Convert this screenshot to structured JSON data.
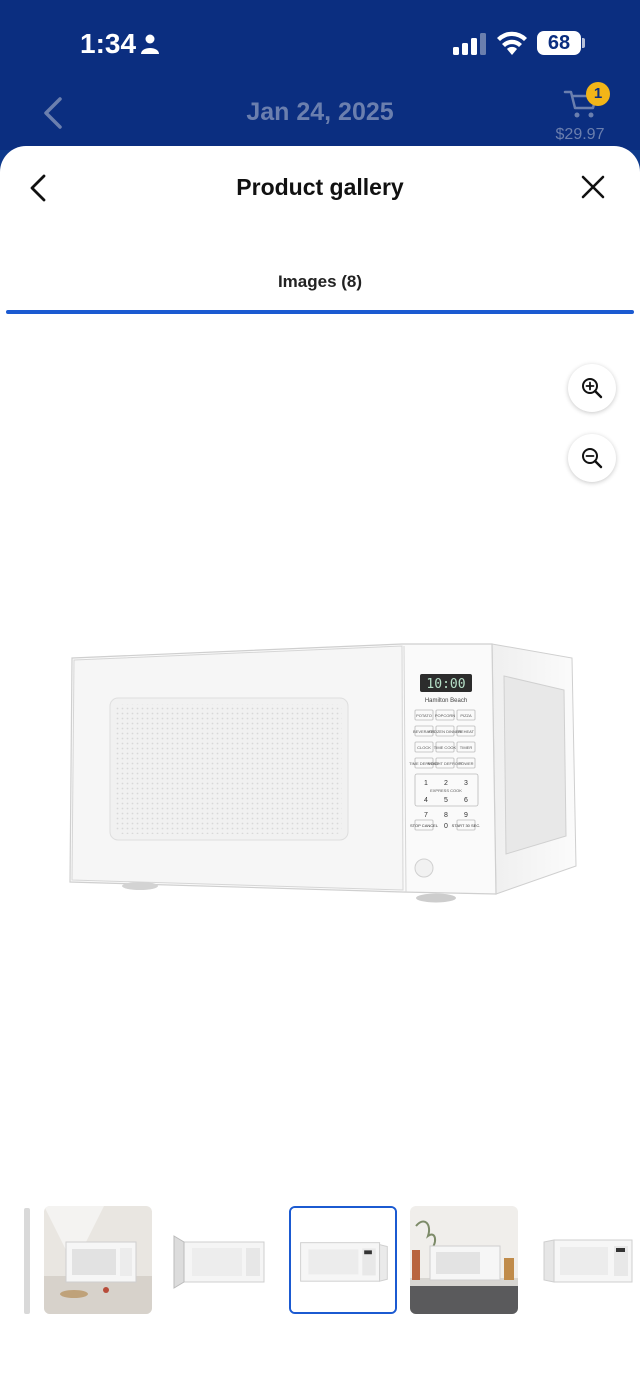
{
  "status_bar": {
    "time": "1:34",
    "battery": "68"
  },
  "app_header": {
    "date": "Jan 24, 2025",
    "cart_count": "1",
    "cart_total": "$29.97"
  },
  "sheet": {
    "title": "Product gallery",
    "tab_label": "Images (8)"
  },
  "icons": {
    "back": "chevron-left-icon",
    "close": "close-icon",
    "zoom_in": "zoom-in-icon",
    "zoom_out": "zoom-out-icon",
    "cart": "cart-icon"
  },
  "product": {
    "brand": "Hamilton Beach",
    "display": "10:00",
    "keypad": {
      "row1": [
        "POTATO",
        "POPCORN",
        "PIZZA"
      ],
      "row2": [
        "BEVERAGE",
        "FROZEN DINNER",
        "REHEAT"
      ],
      "row3": [
        "CLOCK",
        "TIME COOK",
        "TIMER"
      ],
      "row4": [
        "TIME DEFROST",
        "WEIGHT DEFROST",
        "POWER"
      ],
      "express_label": "EXPRESS COOK",
      "digits": [
        "1",
        "2",
        "3",
        "4",
        "5",
        "6",
        "7",
        "8",
        "9"
      ],
      "bottom": [
        "STOP CANCEL",
        "0",
        "START 30 SEC."
      ]
    }
  },
  "thumbnails": {
    "count": 5,
    "selected_index": 2
  },
  "colors": {
    "header_bg": "#0b2e80",
    "accent": "#1b5ad1",
    "badge": "#f2b518"
  }
}
